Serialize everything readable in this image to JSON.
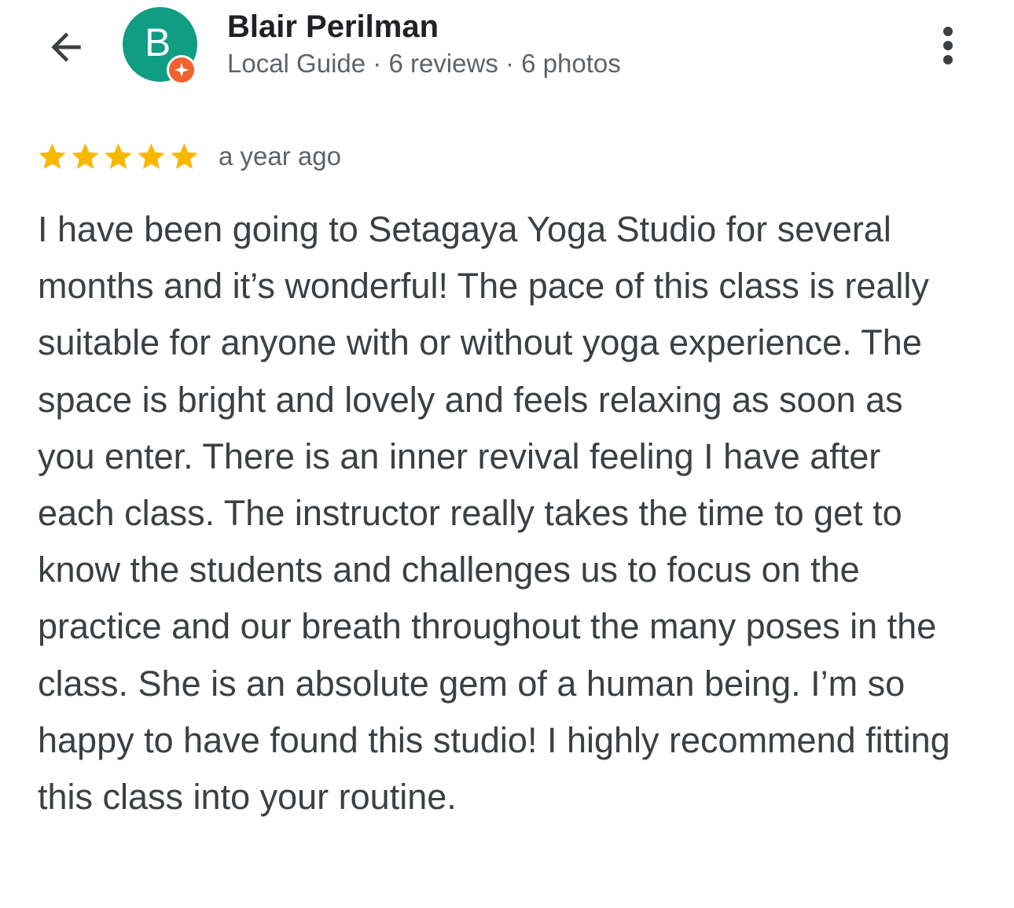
{
  "header": {
    "back_icon": "arrow-left-icon",
    "avatar_letter": "B",
    "avatar_color": "#0f9d84",
    "badge_color": "#f2612f",
    "badge_icon": "local-guide-star-icon",
    "author_name": "Blair Perilman",
    "author_meta": "Local Guide · 6 reviews · 6 photos",
    "more_icon": "more-vertical-icon"
  },
  "review": {
    "rating": 5,
    "max_rating": 5,
    "star_color": "#f9b800",
    "date": "a year ago",
    "text": "I have been going to Setagaya Yoga Studio for several months and it’s wonderful! The pace of this class is really suitable for anyone with or without yoga experience. The space is bright and lovely and feels relaxing as soon as you enter. There is an inner revival feeling I have after each class. The instructor really takes the time to get to know the students and challenges us to focus on the practice and our breath throughout the many poses in the class. She is an absolute gem of a human being. I’m so happy to have found this studio! I highly recommend fitting this class into your routine."
  }
}
